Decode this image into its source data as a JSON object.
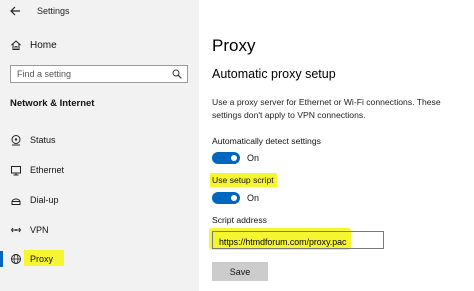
{
  "window": {
    "title": "Settings"
  },
  "sidebar": {
    "home_label": "Home",
    "search_placeholder": "Find a setting",
    "section_heading": "Network & Internet",
    "items": [
      {
        "label": "Status",
        "icon": "status-icon"
      },
      {
        "label": "Ethernet",
        "icon": "ethernet-icon"
      },
      {
        "label": "Dial-up",
        "icon": "dialup-icon"
      },
      {
        "label": "VPN",
        "icon": "vpn-icon"
      },
      {
        "label": "Proxy",
        "icon": "globe-icon",
        "active": true
      }
    ]
  },
  "main": {
    "page_title": "Proxy",
    "section_title": "Automatic proxy setup",
    "description": "Use a proxy server for Ethernet or Wi-Fi connections. These settings don't apply to VPN connections.",
    "auto_detect": {
      "label": "Automatically detect settings",
      "state": "On"
    },
    "setup_script": {
      "label": "Use setup script",
      "state": "On"
    },
    "script_address": {
      "label": "Script address",
      "value": "https://htmdforum.com/proxy.pac"
    },
    "save_label": "Save"
  },
  "colors": {
    "accent": "#0067c0",
    "highlight": "#f5f530",
    "sidebar_bg": "#f2f2f2"
  }
}
